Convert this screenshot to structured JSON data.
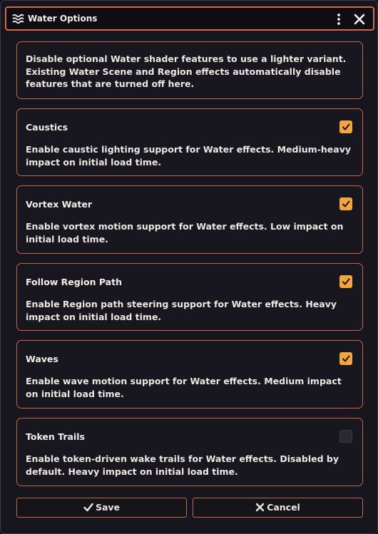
{
  "window": {
    "title": "Water Options",
    "title_icon": "water-waves-icon",
    "menu_icon": "vertical-ellipsis-icon",
    "close_icon": "close-icon"
  },
  "intro": {
    "text": "Disable optional Water shader features to use a lighter variant. Existing Water Scene and Region effects automatically disable features that are turned off here."
  },
  "options": [
    {
      "title": "Caustics",
      "description": "Enable caustic lighting support for Water effects. Medium-heavy impact on initial load time.",
      "checked": true
    },
    {
      "title": "Vortex Water",
      "description": "Enable vortex motion support for Water effects. Low impact on initial load time.",
      "checked": true
    },
    {
      "title": "Follow Region Path",
      "description": "Enable Region path steering support for Water effects. Heavy impact on initial load time.",
      "checked": true
    },
    {
      "title": "Waves",
      "description": "Enable wave motion support for Water effects. Medium impact on initial load time.",
      "checked": true
    },
    {
      "title": "Token Trails",
      "description": "Enable token-driven wake trails for Water effects. Disabled by default. Heavy impact on initial load time.",
      "checked": false
    }
  ],
  "footer": {
    "save_label": "Save",
    "save_icon": "check-icon",
    "cancel_label": "Cancel",
    "cancel_icon": "x-icon"
  },
  "colors": {
    "accent_border": "#c86447",
    "checkbox_on": "#f4a63c",
    "background": "#17161f"
  }
}
